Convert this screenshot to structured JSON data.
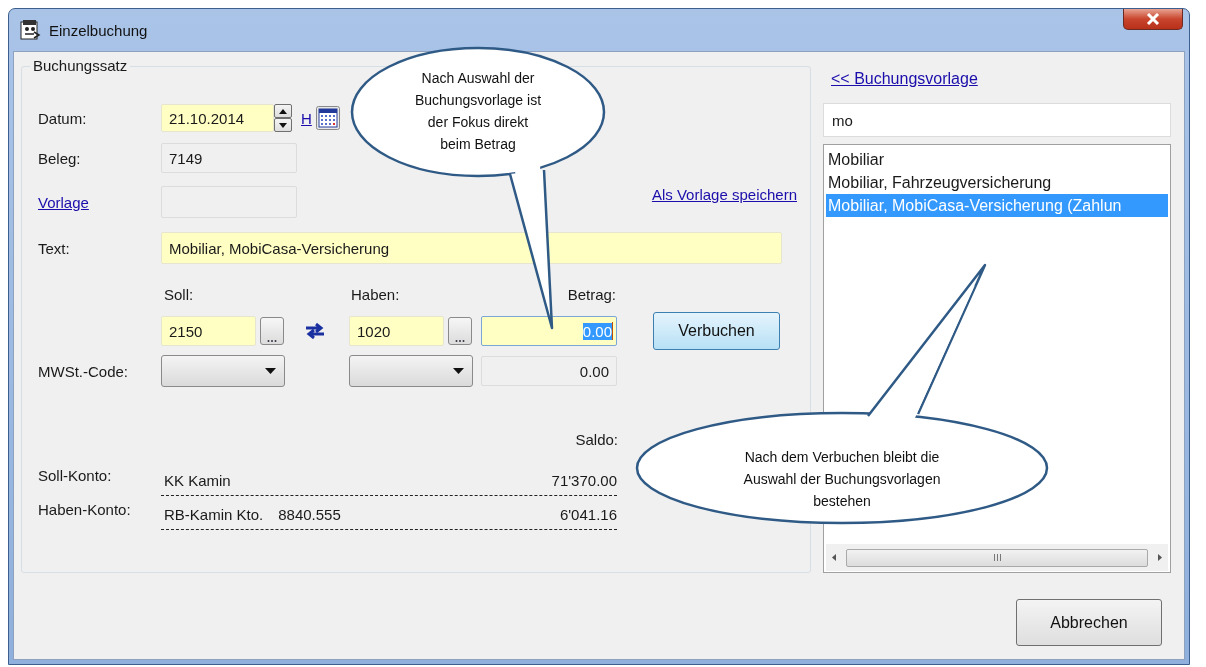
{
  "window": {
    "title": "Einzelbuchung"
  },
  "group_title": "Buchungssatz",
  "datum": {
    "label": "Datum:",
    "value": "21.10.2014",
    "today_link": "H"
  },
  "beleg": {
    "label": "Beleg:",
    "value": "7149"
  },
  "vorlage": {
    "label": "Vorlage"
  },
  "save_template_link": "Als Vorlage speichern",
  "text": {
    "label": "Text:",
    "value": "Mobiliar, MobiCasa-Versicherung"
  },
  "soll": {
    "label": "Soll:",
    "value": "2150"
  },
  "haben": {
    "label": "Haben:",
    "value": "1020"
  },
  "betrag": {
    "label": "Betrag:",
    "value": "0.00",
    "focused": true
  },
  "mwst": {
    "label": "MWSt.-Code:",
    "amount": "0.00"
  },
  "book_button": "Verbuchen",
  "saldo_label": "Saldo:",
  "accounts": [
    {
      "label": "Soll-Konto:",
      "name": "KK Kamin",
      "balance": "71'370.00"
    },
    {
      "label": "Haben-Konto:",
      "name": "RB-Kamin Kto.",
      "number": "8840.555",
      "balance": "6'041.16"
    }
  ],
  "template_panel": {
    "link": "<< Buchungsvorlage",
    "search": "mo",
    "items": [
      {
        "label": "Mobiliar",
        "selected": false
      },
      {
        "label": "Mobiliar, Fahrzeugversicherung",
        "selected": false
      },
      {
        "label": "Mobiliar, MobiCasa-Versicherung (Zahlun",
        "selected": true
      }
    ]
  },
  "cancel_button": "Abbrechen",
  "callouts": [
    {
      "text": "Nach Auswahl der\nBuchungsvorlage ist\nder Fokus direkt\nbeim Betrag"
    },
    {
      "text": "Nach dem Verbuchen bleibt die\nAuswahl der Buchungsvorlagen\nbestehen"
    }
  ]
}
